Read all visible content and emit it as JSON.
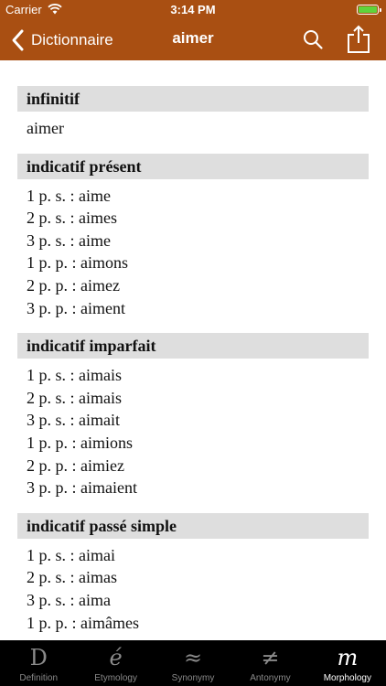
{
  "status_bar": {
    "carrier": "Carrier",
    "time": "3:14 PM",
    "battery_color": "#5fd33b"
  },
  "nav": {
    "back_label": "Dictionnaire",
    "title": "aimer",
    "back_icon": "chevron-left-icon",
    "search_icon": "search-icon",
    "share_icon": "share-icon"
  },
  "colors": {
    "bar": "#a94f12",
    "section_header": "#dedede",
    "tabbar": "#000000"
  },
  "sections": [
    {
      "header": "infinitif",
      "lines": [
        "aimer"
      ]
    },
    {
      "header": "indicatif présent",
      "lines": [
        "1 p. s. : aime",
        "2 p. s. : aimes",
        "3 p. s. : aime",
        "1 p. p. : aimons",
        "2 p. p. : aimez",
        "3 p. p. : aiment"
      ]
    },
    {
      "header": "indicatif imparfait",
      "lines": [
        "1 p. s. : aimais",
        "2 p. s. : aimais",
        "3 p. s. : aimait",
        "1 p. p. : aimions",
        "2 p. p. : aimiez",
        "3 p. p. : aimaient"
      ]
    },
    {
      "header": "indicatif passé simple",
      "lines": [
        "1 p. s. : aimai",
        "2 p. s. : aimas",
        "3 p. s. : aima",
        "1 p. p. : aimâmes"
      ]
    }
  ],
  "tabs": [
    {
      "glyph": "D",
      "label": "Definition",
      "active": false
    },
    {
      "glyph": "é",
      "label": "Etymology",
      "active": false
    },
    {
      "glyph": "≈",
      "label": "Synonymy",
      "active": false
    },
    {
      "glyph": "≠",
      "label": "Antonymy",
      "active": false
    },
    {
      "glyph": "m",
      "label": "Morphology",
      "active": true
    }
  ]
}
